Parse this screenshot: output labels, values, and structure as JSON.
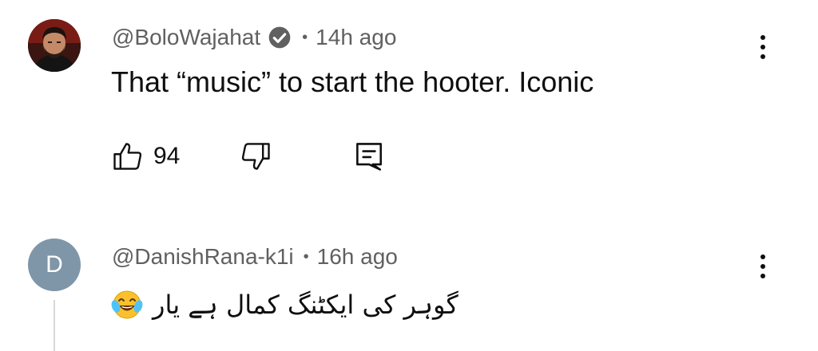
{
  "comments": [
    {
      "author": "@BoloWajahat",
      "verified": true,
      "separator": "•",
      "time": "14h ago",
      "text": "That “music” to start the hooter. Iconic",
      "likes": "94",
      "avatar": "photo"
    },
    {
      "author": "@DanishRana-k1i",
      "separator": "•",
      "time": "16h ago",
      "text": "گوہر کی ایکٹنگ کمال ہے یار",
      "emoji": "😂",
      "avatar_letter": "D",
      "avatar_color": "#7f96a8"
    }
  ],
  "icons": {
    "like": "thumbs-up-icon",
    "dislike": "thumbs-down-icon",
    "reply": "comment-reply-icon",
    "more": "vertical-ellipsis-icon",
    "verified": "verified-check-icon"
  }
}
